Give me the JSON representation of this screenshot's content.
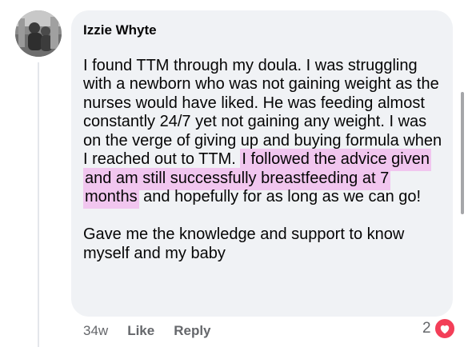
{
  "comment": {
    "author": "Izzie Whyte",
    "text_before": "I found TTM through my doula. I was struggling with a newborn who was not gaining weight as the nurses would have liked. He was feeding almost constantly 24/7 yet not gaining any weight. I was on the verge of giving up and buying formula when I reached out to TTM. ",
    "text_highlight": "I followed the advice given and am still successfully breastfeeding at 7 months",
    "text_after": " and hopefully for as long as we can go!",
    "text_second": "Gave me the knowledge and support to know myself and my baby",
    "timestamp": "34w",
    "like_label": "Like",
    "reply_label": "Reply",
    "reaction_count": "2",
    "reaction_icon": "heart-icon"
  },
  "colors": {
    "bubble": "#f0f2f5",
    "highlight": "#f1c6ef",
    "heart": "#f33e58",
    "meta_text": "#65676b"
  }
}
